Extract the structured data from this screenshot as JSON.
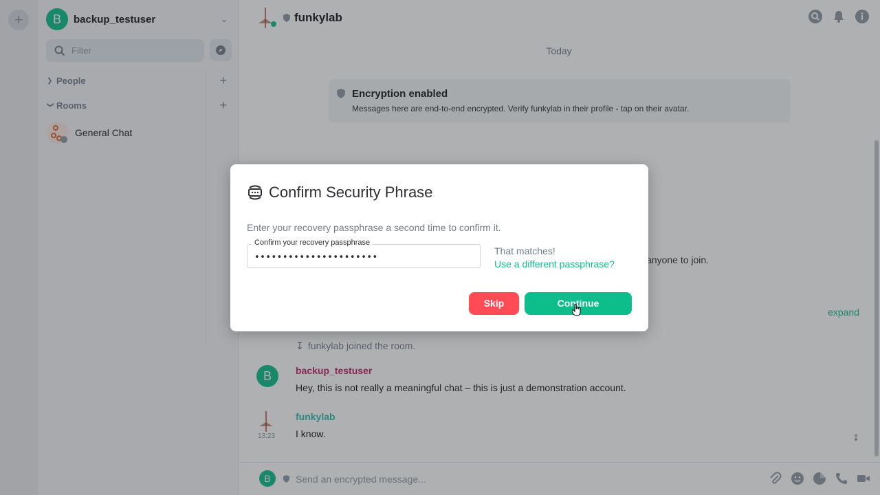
{
  "sidebar": {
    "user_initial": "B",
    "user_name": "backup_testuser",
    "filter_placeholder": "Filter",
    "sections": [
      {
        "label": "People"
      },
      {
        "label": "Rooms"
      }
    ],
    "rooms": [
      {
        "label": "General Chat"
      }
    ]
  },
  "room": {
    "title": "funkylab",
    "date_separator": "Today",
    "encryption": {
      "title": "Encryption enabled",
      "description": "Messages here are end-to-end encrypted. Verify funkylab in their profile - tap on their avatar."
    },
    "partially_hidden_text": "anyone to join.",
    "expand_label": "expand",
    "event_text": "funkylab joined the room.",
    "messages": [
      {
        "sender": "backup_testuser",
        "avatar_initial": "B",
        "body": "Hey, this is not really a meaningful chat – this is just a demonstration account.",
        "color": "#c1216a"
      },
      {
        "sender": "funkylab",
        "time": "13:23",
        "body": "I know.",
        "color": "#2dbfad"
      }
    ],
    "composer": {
      "avatar_initial": "B",
      "placeholder": "Send an encrypted message..."
    }
  },
  "dialog": {
    "title": "Confirm Security Phrase",
    "description": "Enter your recovery passphrase a second time to confirm it.",
    "field_label": "Confirm your recovery passphrase",
    "field_value": "••••••••••••••••••••••",
    "match_text": "That matches!",
    "different_link": "Use a different passphrase?",
    "skip_label": "Skip",
    "continue_label": "Continue"
  },
  "colors": {
    "accent": "#0dbd8b",
    "danger": "#ff4b55",
    "overlay": "rgba(46,48,51,0.38)"
  }
}
